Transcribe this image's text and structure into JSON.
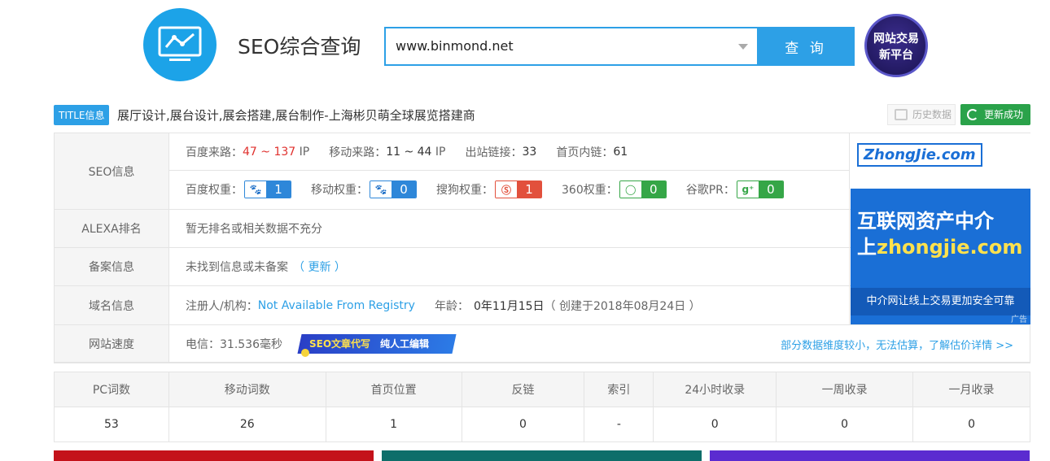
{
  "header": {
    "site_title": "SEO综合查询",
    "search_value": "www.binmond.net",
    "search_button": "查 询",
    "promo_line1": "网站交易",
    "promo_line2": "新平台"
  },
  "title_row": {
    "tag": "TITLE信息",
    "text": "展厅设计,展台设计,展会搭建,展台制作-上海彬贝萌全球展览搭建商",
    "history_button": "历史数据",
    "update_button": "更新成功"
  },
  "seo": {
    "label": "SEO信息",
    "baidu_source_label": "百度来路：",
    "baidu_source_value": "47 ~ 137",
    "baidu_source_unit": "IP",
    "mobile_source_label": "移动来路：",
    "mobile_source_value": "11 ~ 44",
    "mobile_source_unit": "IP",
    "outbound_label": "出站链接：",
    "outbound_value": "33",
    "internal_label": "首页内链：",
    "internal_value": "61",
    "weights": [
      {
        "label": "百度权重：",
        "value": "1"
      },
      {
        "label": "移动权重：",
        "value": "0"
      },
      {
        "label": "搜狗权重：",
        "value": "1"
      },
      {
        "label": "360权重：",
        "value": "0"
      },
      {
        "label": "谷歌PR：",
        "value": "0"
      }
    ]
  },
  "alexa": {
    "label": "ALEXA排名",
    "text": "暂无排名或相关数据不充分"
  },
  "beian": {
    "label": "备案信息",
    "text": "未找到信息或未备案",
    "update_link": "（ 更新 ）"
  },
  "domain": {
    "label": "域名信息",
    "registrant_label": "注册人/机构：",
    "registrant_value": "Not Available From Registry",
    "age_label": "年龄：",
    "age_value": "0年11月15日",
    "created": "（ 创建于2018年08月24日 ）"
  },
  "speed": {
    "label": "网站速度",
    "telecom": "电信：31.536毫秒",
    "banner_left": "SEO文章代写",
    "banner_right": "纯人工编辑",
    "detail_link": "部分数据维度较小，无法估算，了解估价详情 >>"
  },
  "ad": {
    "logo": "ZhongJie.com",
    "line1": "互联网资产中介",
    "line2_prefix": "上",
    "line2_domain": "zhongjie.com",
    "bottom": "中介网让线上交易更加安全可靠",
    "tag": "广告"
  },
  "stats": {
    "headers": [
      "PC词数",
      "移动词数",
      "首页位置",
      "反链",
      "索引",
      "24小时收录",
      "一周收录",
      "一月收录"
    ],
    "values": [
      "53",
      "26",
      "1",
      "0",
      "-",
      "0",
      "0",
      "0"
    ]
  },
  "colors": {
    "accent": "#2da0e6",
    "green": "#2aa24a",
    "red": "#e0312e"
  }
}
